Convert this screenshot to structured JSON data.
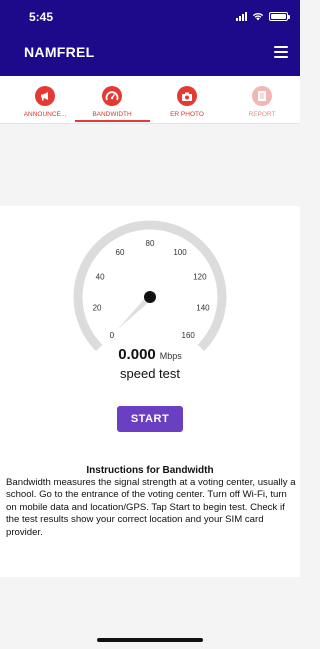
{
  "status_bar": {
    "time": "5:45"
  },
  "header": {
    "title": "NAMFREL"
  },
  "tabs": [
    {
      "label": "ANNOUNCE...",
      "icon": "megaphone-icon",
      "active": false
    },
    {
      "label": "BANDWIDTH",
      "icon": "speedometer-icon",
      "active": true
    },
    {
      "label": "ER PHOTO",
      "icon": "camera-icon",
      "active": false
    },
    {
      "label": "REPORT",
      "icon": "report-icon",
      "active": false
    }
  ],
  "gauge": {
    "ticks": [
      "0",
      "20",
      "40",
      "60",
      "80",
      "100",
      "120",
      "140",
      "160"
    ],
    "min": 0,
    "max": 160,
    "needle_value": 0
  },
  "speed": {
    "value": "0.000",
    "unit": "Mbps",
    "label": "speed test"
  },
  "start_button": {
    "label": "START"
  },
  "instructions": {
    "title": "Instructions for Bandwidth",
    "body": "Bandwidth measures the signal strength at a voting center, usually a school. Go to the entrance of the voting center. Turn off Wi-Fi, turn on mobile data and location/GPS. Tap Start to begin test. Check if the test results show your correct location and your SIM card provider."
  },
  "colors": {
    "header": "#1c0a8a",
    "accent": "#e53a33",
    "button": "#6b3fc1"
  }
}
